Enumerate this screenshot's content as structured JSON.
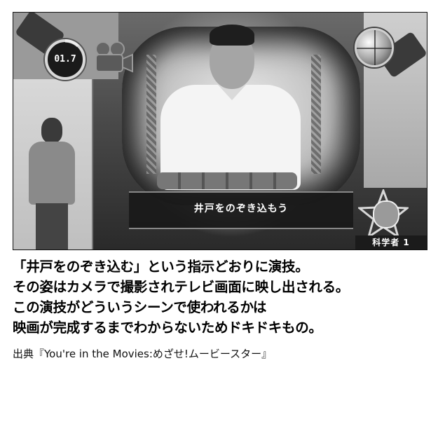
{
  "screenshot": {
    "timer_value": "01.7",
    "caption": "井戸をのぞき込もう",
    "player_label": "科学者 1"
  },
  "description_lines": [
    "「井戸をのぞき込む」という指示どおりに演技。",
    "その姿はカメラで撮影されテレビ画面に映し出される。",
    "この演技がどういうシーンで使われるかは",
    "映画が完成するまでわからないためドキドキもの。"
  ],
  "source_credit": "出典『You're in the Movies:めざせ!ムービースター』",
  "icons": {
    "timer": "timer-ring-icon",
    "camera": "movie-camera-icon",
    "record": "record-ball-icon",
    "badge": "star-badge-icon"
  },
  "colors": {
    "caption_bg": "#191919",
    "caption_text": "#ffffff",
    "text": "#000000"
  }
}
